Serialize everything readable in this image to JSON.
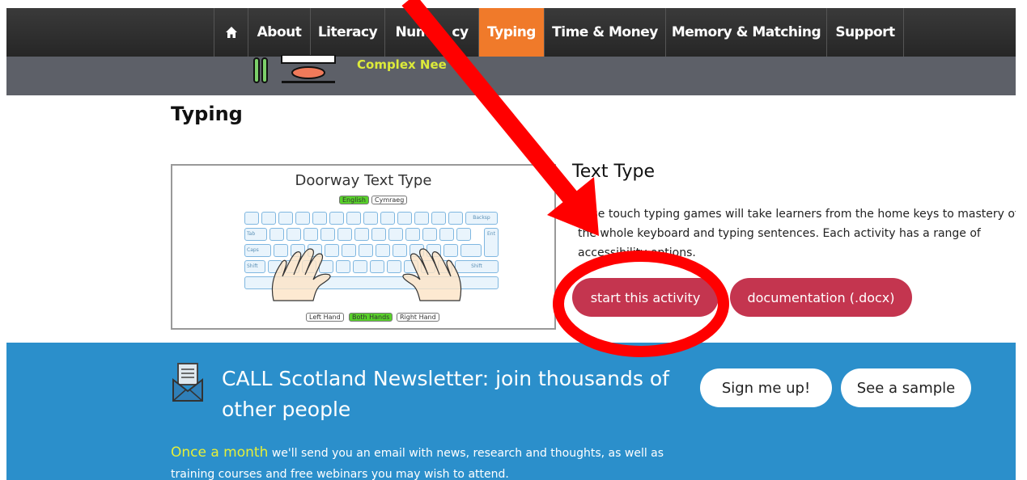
{
  "nav": {
    "home_icon": "home-icon",
    "items": [
      {
        "label": "About"
      },
      {
        "label": "Literacy"
      },
      {
        "label": "Num cy"
      },
      {
        "label": "Typing",
        "active": true
      },
      {
        "label": "Time & Money"
      },
      {
        "label": "Memory & Matching"
      },
      {
        "label": "Support"
      }
    ]
  },
  "header": {
    "tagline": "Complex Nee"
  },
  "page": {
    "title": "Typing"
  },
  "activity": {
    "thumbnail": {
      "title": "Doorway Text Type",
      "lang_english": "English",
      "lang_cymraeg": "Cymraeg",
      "left_hand": "Left Hand",
      "both_hands": "Both Hands",
      "right_hand": "Right Hand",
      "key_labels": {
        "backspace": "Backsp",
        "tab": "Tab",
        "caps": "Caps",
        "shift": "Shift",
        "enter": "Ent"
      }
    },
    "title": "Text Type",
    "description": "hese touch typing games will take learners from the home keys to mastery of the whole keyboard and typing sentences. Each activity has a range of accessibility options.",
    "start_button": "start this activity",
    "docs_button": "documentation (.docx)"
  },
  "newsletter": {
    "icon": "envelope-icon",
    "title": "CALL Scotland Newsletter: join thousands of other people",
    "highlight": "Once a month",
    "text": " we'll send you an email with news, research and thoughts, as well as training courses and free webinars you may wish to attend.",
    "signup_button": "Sign me up!",
    "sample_button": "See a sample"
  },
  "colors": {
    "nav_bg": "#2d2d2d",
    "nav_active": "#f07a2a",
    "header_band": "#5d6068",
    "button_red": "#c4354f",
    "newsletter_bg": "#2b8fcb",
    "highlight_yellow": "#e5ef3a",
    "annotation_red": "#ff0000"
  }
}
